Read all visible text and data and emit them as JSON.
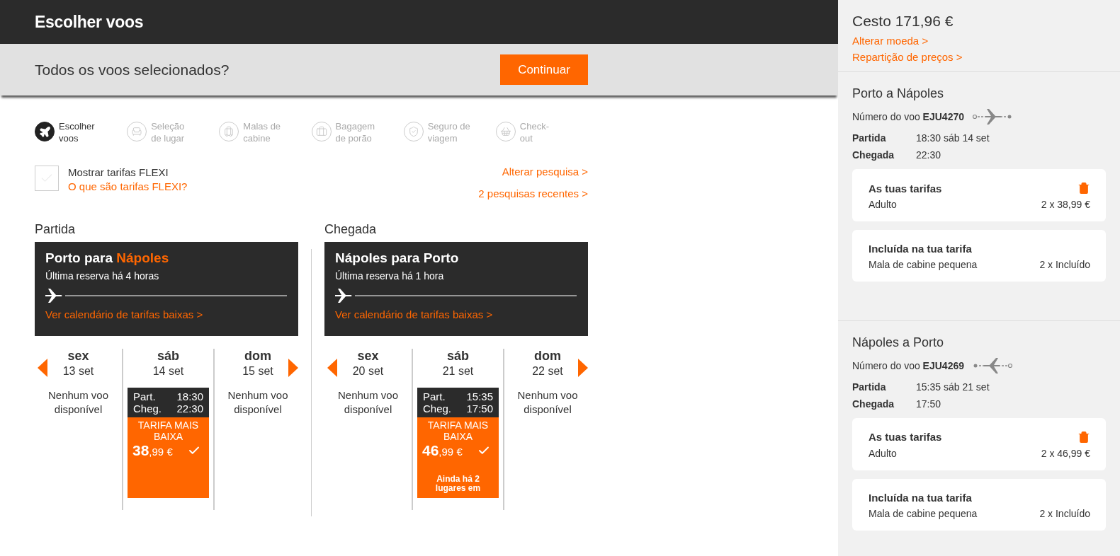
{
  "header": {
    "title": "Escolher voos"
  },
  "prompt": {
    "text": "Todos os voos selecionados?",
    "button": "Continuar"
  },
  "steps": [
    {
      "label": "Escolher voos",
      "kind": "plane",
      "active": true
    },
    {
      "label": "Seleção de lugar",
      "kind": "seat",
      "active": false
    },
    {
      "label": "Malas de cabine",
      "kind": "suitcase",
      "active": false
    },
    {
      "label": "Bagagem de porão",
      "kind": "bag",
      "active": false
    },
    {
      "label": "Seguro de viagem",
      "kind": "shield",
      "active": false
    },
    {
      "label": "Check-out",
      "kind": "basket",
      "active": false
    }
  ],
  "flexi": {
    "label": "Mostrar tarifas FLEXI",
    "checked": false,
    "link": "O que são tarifas FLEXI?"
  },
  "links": [
    "Alterar pesquisa >",
    "2 pesquisas recentes >"
  ],
  "journeys": [
    {
      "heading": "Partida",
      "from": "Porto",
      "connector": "para",
      "to": "Nápoles",
      "highlight_to": true,
      "last_booking": "Última reserva há 4 horas",
      "calendar_link": "Ver calendário de tarifas baixas >",
      "days": [
        {
          "weekday": "sex",
          "date": "13 set",
          "message": "Nenhum voo disponível"
        },
        {
          "weekday": "sáb",
          "date": "14 set",
          "flight": {
            "dep_label": "Part.",
            "dep": "18:30",
            "arr_label": "Cheg.",
            "arr": "22:30",
            "fare": "TARIFA MAIS BAIXA",
            "price_whole": "38",
            "price_rest": ",99 €",
            "selected": true
          }
        },
        {
          "weekday": "dom",
          "date": "15 set",
          "message": "Nenhum voo disponível"
        }
      ]
    },
    {
      "heading": "Chegada",
      "from": "Nápoles",
      "connector": "para",
      "to": "Porto",
      "highlight_to": false,
      "last_booking": "Última reserva há 1 hora",
      "calendar_link": "Ver calendário de tarifas baixas >",
      "days": [
        {
          "weekday": "sex",
          "date": "20 set",
          "message": "Nenhum voo disponível"
        },
        {
          "weekday": "sáb",
          "date": "21 set",
          "flight": {
            "dep_label": "Part.",
            "dep": "15:35",
            "arr_label": "Cheg.",
            "arr": "17:50",
            "fare": "TARIFA MAIS BAIXA",
            "price_whole": "46",
            "price_rest": ",99 €",
            "selected": true,
            "note": "Ainda há 2 lugares em"
          }
        },
        {
          "weekday": "dom",
          "date": "22 set",
          "message": "Nenhum voo disponível"
        }
      ]
    }
  ],
  "basket": {
    "title": "Cesto 171,96 €",
    "links": [
      "Alterar moeda >",
      "Repartição de preços >"
    ],
    "flights": [
      {
        "route": "Porto a Nápoles",
        "kind": "outbound",
        "number_label": "Número do voo",
        "number": "EJU4270",
        "dep_label": "Partida",
        "dep": "18:30 sáb 14 set",
        "arr_label": "Chegada",
        "arr": "22:30",
        "fares_title": "As tuas tarifas",
        "passenger": "Adulto",
        "fare": "2 x 38,99 €",
        "included_title": "Incluída na tua tarifa",
        "included_item": "Mala de cabine pequena",
        "included_value": "2 x Incluído"
      },
      {
        "route": "Nápoles a Porto",
        "kind": "return",
        "number_label": "Número do voo",
        "number": "EJU4269",
        "dep_label": "Partida",
        "dep": "15:35 sáb 21 set",
        "arr_label": "Chegada",
        "arr": "17:50",
        "fares_title": "As tuas tarifas",
        "passenger": "Adulto",
        "fare": "2 x 46,99 €",
        "included_title": "Incluída na tua tarifa",
        "included_item": "Mala de cabine pequena",
        "included_value": "2 x Incluído"
      }
    ]
  }
}
